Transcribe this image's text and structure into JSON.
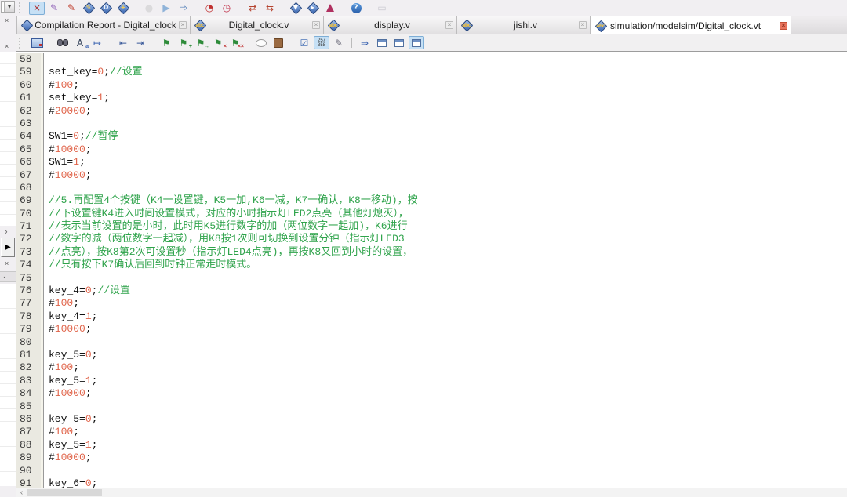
{
  "left_panel": {
    "dropdown_glyph": "▾",
    "close_glyph": "×",
    "chevron_glyph": "›",
    "play_glyph": "▶",
    "dot_glyph": "."
  },
  "toolbar_top": {
    "icons": [
      {
        "kind": "grip",
        "name": "toolbar-grip"
      },
      {
        "kind": "glyph",
        "name": "selected-tool-icon",
        "glyph": "×",
        "color": "#b03838",
        "hl": true
      },
      {
        "kind": "glyph",
        "name": "edit-wand-icon",
        "glyph": "✎",
        "color": "#8a5ab5"
      },
      {
        "kind": "glyph",
        "name": "red-pencil-icon",
        "glyph": "✎",
        "color": "#c04030"
      },
      {
        "kind": "diamond",
        "name": "assignment-editor-icon",
        "overlay": "✎",
        "overlay_color": "#ffd24a"
      },
      {
        "kind": "diamond",
        "name": "device-settings-icon",
        "overlay": "D",
        "overlay_color": "#ffffff"
      },
      {
        "kind": "diamond",
        "name": "pin-planner-icon",
        "overlay": "+",
        "overlay_color": "#ffd24a"
      },
      {
        "kind": "sep"
      },
      {
        "kind": "glyph",
        "name": "stop-processing-icon",
        "glyph": "●",
        "color": "#c2c2c2",
        "dis": true
      },
      {
        "kind": "glyph",
        "name": "start-compilation-icon",
        "glyph": "▶",
        "color": "#8fb3d9"
      },
      {
        "kind": "glyph",
        "name": "rapid-recompile-icon",
        "glyph": "⇨",
        "color": "#4a7ab5"
      },
      {
        "kind": "sep"
      },
      {
        "kind": "glyph",
        "name": "timing-analyzer-icon",
        "glyph": "◔",
        "color": "#c03030"
      },
      {
        "kind": "glyph",
        "name": "stopwatch-icon",
        "glyph": "◷",
        "color": "#c03048"
      },
      {
        "kind": "sep"
      },
      {
        "kind": "glyph",
        "name": "rtl-viewer-icon",
        "glyph": "⇄",
        "color": "#b5432f"
      },
      {
        "kind": "glyph",
        "name": "tech-map-viewer-icon",
        "glyph": "⇆",
        "color": "#b5432f"
      },
      {
        "kind": "sep"
      },
      {
        "kind": "diamond",
        "name": "programmer-icon",
        "overlay": "▼",
        "overlay_color": "#ffffff"
      },
      {
        "kind": "diamond",
        "name": "signal-tap-icon",
        "overlay": "▸",
        "overlay_color": "#ffffff"
      },
      {
        "kind": "css",
        "name": "system-builder-icon",
        "css": "flask"
      },
      {
        "kind": "sep"
      },
      {
        "kind": "glyph",
        "name": "help-icon",
        "glyph": "?",
        "color": "#ffffff",
        "cls": "circ"
      },
      {
        "kind": "sep"
      },
      {
        "kind": "glyph",
        "name": "feedback-icon",
        "glyph": "▭",
        "color": "#9a9aa8",
        "dis": true
      }
    ]
  },
  "tabs": [
    {
      "name": "tab-compilation-report",
      "label": "Compilation Report - Digital_clock",
      "icon": "report",
      "icon_text": "",
      "close_glyph": "×",
      "active": false
    },
    {
      "name": "tab-digital-clock-v",
      "label": "Digital_clock.v",
      "icon": "abc",
      "icon_text": "abc",
      "close_glyph": "×",
      "active": false
    },
    {
      "name": "tab-display-v",
      "label": "display.v",
      "icon": "abc",
      "icon_text": "abc",
      "close_glyph": "×",
      "active": false
    },
    {
      "name": "tab-jishi-v",
      "label": "jishi.v",
      "icon": "abc",
      "icon_text": "abc",
      "close_glyph": "×",
      "active": false
    },
    {
      "name": "tab-digital-clock-vt",
      "label": "simulation/modelsim/Digital_clock.vt",
      "icon": "abc",
      "icon_text": "abc",
      "close_glyph": "×",
      "active": true
    }
  ],
  "toolbar_editor": {
    "icons": [
      {
        "kind": "grip",
        "name": "toolbar-grip"
      },
      {
        "kind": "css",
        "name": "editor-display-icon",
        "css": "mon"
      },
      {
        "kind": "sep"
      },
      {
        "kind": "css",
        "name": "find-icon",
        "css": "binoc"
      },
      {
        "kind": "glyph",
        "name": "find-replace-icon",
        "glyph": "A",
        "color": "#20304a",
        "badge": "a",
        "badge_color": "#3a62b0"
      },
      {
        "kind": "glyph",
        "name": "goto-line-icon",
        "glyph": "↦",
        "color": "#3a62b0"
      },
      {
        "kind": "sep"
      },
      {
        "kind": "glyph",
        "name": "indent-icon",
        "glyph": "⇤",
        "color": "#3a5a9a"
      },
      {
        "kind": "glyph",
        "name": "outdent-icon",
        "glyph": "⇥",
        "color": "#3a5a9a"
      },
      {
        "kind": "sep"
      },
      {
        "kind": "glyph",
        "name": "toggle-bookmark-icon",
        "glyph": "⚑",
        "color": "#2e8b3a"
      },
      {
        "kind": "glyph",
        "name": "add-bookmark-icon",
        "glyph": "⚑",
        "color": "#2e8b3a",
        "badge": "+",
        "badge_color": "#2e8b3a"
      },
      {
        "kind": "glyph",
        "name": "next-bookmark-icon",
        "glyph": "⚑",
        "color": "#2e8b3a",
        "badge": "→",
        "badge_color": "#2e8b3a"
      },
      {
        "kind": "glyph",
        "name": "delete-bookmark-icon",
        "glyph": "⚑",
        "color": "#2e8b3a",
        "badge": "×",
        "badge_color": "#c03030"
      },
      {
        "kind": "glyph",
        "name": "delete-all-bookmarks-icon",
        "glyph": "⚑",
        "color": "#2e8b3a",
        "badge": "××",
        "badge_color": "#c03030"
      },
      {
        "kind": "sep"
      },
      {
        "kind": "css",
        "name": "comment-icon",
        "css": "oval"
      },
      {
        "kind": "css",
        "name": "uncomment-icon",
        "css": "brown"
      },
      {
        "kind": "sep"
      },
      {
        "kind": "glyph",
        "name": "analyze-current-file-icon",
        "glyph": "☑",
        "color": "#2f5fae"
      },
      {
        "kind": "num",
        "name": "line-numbers-icon",
        "rows": [
          "257",
          "358"
        ],
        "hl": true
      },
      {
        "kind": "glyph",
        "name": "stamp-icon",
        "glyph": "✎",
        "color": "#6b6b7a"
      },
      {
        "kind": "div"
      },
      {
        "kind": "glyph",
        "name": "insert-template-icon",
        "glyph": "⇒",
        "color": "#3a62b0"
      },
      {
        "kind": "css",
        "name": "window-icon-1",
        "css": "win"
      },
      {
        "kind": "css",
        "name": "window-icon-2",
        "css": "win"
      },
      {
        "kind": "css",
        "name": "window-icon-3",
        "css": "win",
        "hl": true
      }
    ]
  },
  "editor": {
    "lines": [
      {
        "n": "58",
        "s": []
      },
      {
        "n": "59",
        "s": [
          [
            "k",
            "set_key="
          ],
          [
            "n",
            "0"
          ],
          [
            "k",
            ";"
          ],
          [
            "c",
            "//设置"
          ]
        ]
      },
      {
        "n": "60",
        "s": [
          [
            "k",
            "#"
          ],
          [
            "n",
            "100"
          ],
          [
            "k",
            ";"
          ]
        ]
      },
      {
        "n": "61",
        "s": [
          [
            "k",
            "set_key="
          ],
          [
            "n",
            "1"
          ],
          [
            "k",
            ";"
          ]
        ]
      },
      {
        "n": "62",
        "s": [
          [
            "k",
            "#"
          ],
          [
            "n",
            "20000"
          ],
          [
            "k",
            ";"
          ]
        ]
      },
      {
        "n": "63",
        "s": []
      },
      {
        "n": "64",
        "s": [
          [
            "k",
            "SW1="
          ],
          [
            "n",
            "0"
          ],
          [
            "k",
            ";"
          ],
          [
            "c",
            "//暂停"
          ]
        ]
      },
      {
        "n": "65",
        "s": [
          [
            "k",
            "#"
          ],
          [
            "n",
            "10000"
          ],
          [
            "k",
            ";"
          ]
        ]
      },
      {
        "n": "66",
        "s": [
          [
            "k",
            "SW1="
          ],
          [
            "n",
            "1"
          ],
          [
            "k",
            ";"
          ]
        ]
      },
      {
        "n": "67",
        "s": [
          [
            "k",
            "#"
          ],
          [
            "n",
            "10000"
          ],
          [
            "k",
            ";"
          ]
        ]
      },
      {
        "n": "68",
        "s": []
      },
      {
        "n": "69",
        "s": [
          [
            "c",
            "//5.再配置4个按键（K4一设置键，K5一加,K6一减，K7一确认，K8一移动)，按"
          ]
        ]
      },
      {
        "n": "70",
        "s": [
          [
            "c",
            "//下设置键K4进入时间设置模式，对应的小时指示灯LED2点亮（其他灯熄灭），"
          ]
        ]
      },
      {
        "n": "71",
        "s": [
          [
            "c",
            "//表示当前设置的是小时，此时用K5进行数字的加（两位数字一起加)，K6进行"
          ]
        ]
      },
      {
        "n": "72",
        "s": [
          [
            "c",
            "//数字的减（两位数字一起减），用K8按1次则可切换到设置分钟（指示灯LED3"
          ]
        ]
      },
      {
        "n": "73",
        "s": [
          [
            "c",
            "//点亮），按K8第2次可设置秒（指示灯LED4点亮)，再按K8又回到小时的设置，"
          ]
        ]
      },
      {
        "n": "74",
        "s": [
          [
            "c",
            "//只有按下K7确认后回到时钟正常走时模式。"
          ]
        ]
      },
      {
        "n": "75",
        "s": []
      },
      {
        "n": "76",
        "s": [
          [
            "k",
            "key_4="
          ],
          [
            "n",
            "0"
          ],
          [
            "k",
            ";"
          ],
          [
            "c",
            "//设置"
          ]
        ]
      },
      {
        "n": "77",
        "s": [
          [
            "k",
            "#"
          ],
          [
            "n",
            "100"
          ],
          [
            "k",
            ";"
          ]
        ]
      },
      {
        "n": "78",
        "s": [
          [
            "k",
            "key_4="
          ],
          [
            "n",
            "1"
          ],
          [
            "k",
            ";"
          ]
        ]
      },
      {
        "n": "79",
        "s": [
          [
            "k",
            "#"
          ],
          [
            "n",
            "10000"
          ],
          [
            "k",
            ";"
          ]
        ]
      },
      {
        "n": "80",
        "s": []
      },
      {
        "n": "81",
        "s": [
          [
            "k",
            "key_5="
          ],
          [
            "n",
            "0"
          ],
          [
            "k",
            ";"
          ]
        ]
      },
      {
        "n": "82",
        "s": [
          [
            "k",
            "#"
          ],
          [
            "n",
            "100"
          ],
          [
            "k",
            ";"
          ]
        ]
      },
      {
        "n": "83",
        "s": [
          [
            "k",
            "key_5="
          ],
          [
            "n",
            "1"
          ],
          [
            "k",
            ";"
          ]
        ]
      },
      {
        "n": "84",
        "s": [
          [
            "k",
            "#"
          ],
          [
            "n",
            "10000"
          ],
          [
            "k",
            ";"
          ]
        ]
      },
      {
        "n": "85",
        "s": []
      },
      {
        "n": "86",
        "s": [
          [
            "k",
            "key_5="
          ],
          [
            "n",
            "0"
          ],
          [
            "k",
            ";"
          ]
        ]
      },
      {
        "n": "87",
        "s": [
          [
            "k",
            "#"
          ],
          [
            "n",
            "100"
          ],
          [
            "k",
            ";"
          ]
        ]
      },
      {
        "n": "88",
        "s": [
          [
            "k",
            "key_5="
          ],
          [
            "n",
            "1"
          ],
          [
            "k",
            ";"
          ]
        ]
      },
      {
        "n": "89",
        "s": [
          [
            "k",
            "#"
          ],
          [
            "n",
            "10000"
          ],
          [
            "k",
            ";"
          ]
        ]
      },
      {
        "n": "90",
        "s": []
      },
      {
        "n": "91",
        "s": [
          [
            "k",
            "key_6="
          ],
          [
            "n",
            "0"
          ],
          [
            "k",
            ";"
          ]
        ]
      }
    ]
  },
  "scrollbar": {
    "left_arrow": "‹"
  },
  "colors": {
    "number_literal": "#e0644a",
    "comment": "#2fa34b",
    "identifier": "#111111",
    "gutter_bg": "#eae9e1",
    "active_tab_close": "#e8735c",
    "selected_icon_bg": "#c6e0f5"
  }
}
